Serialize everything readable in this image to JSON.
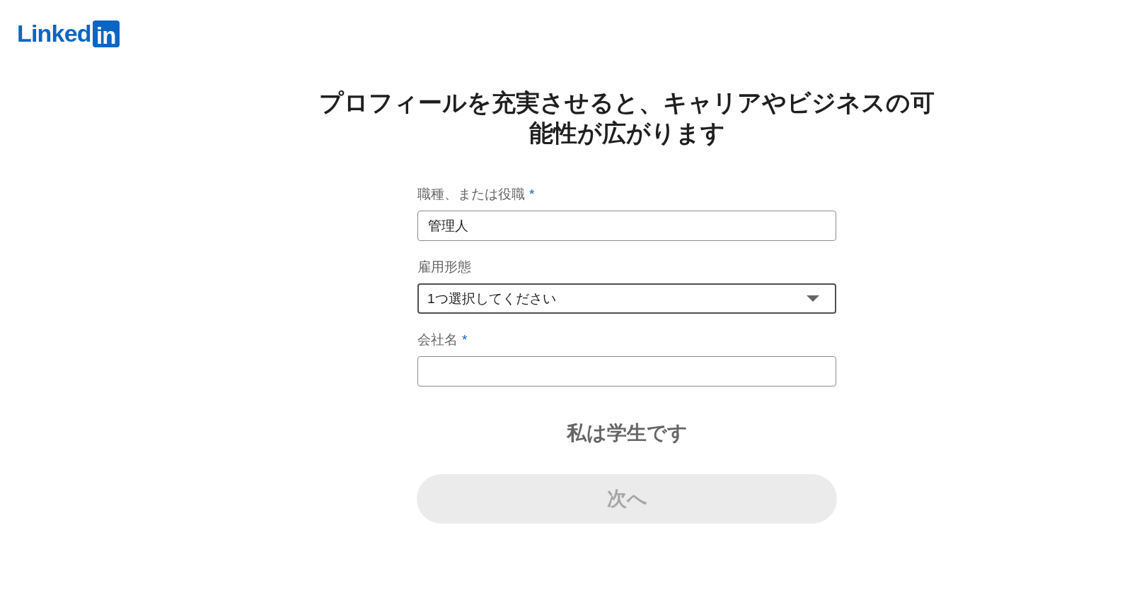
{
  "logo": {
    "wordmark": "Linked",
    "badge": "in"
  },
  "heading": "プロフィールを充実させると、キャリアやビジネスの可能性が広がります",
  "fields": [
    {
      "kind": "text",
      "label": "職種、または役職",
      "required_mark": "*",
      "value": "管理人",
      "focused": false
    },
    {
      "kind": "select",
      "label": "雇用形態",
      "value": "1つ選択してください",
      "focused": true
    },
    {
      "kind": "text",
      "label": "会社名",
      "required_mark": "*",
      "focused": false
    }
  ],
  "student_link": "私は学生です",
  "next_button": {
    "label": "次へ",
    "disabled": true
  }
}
